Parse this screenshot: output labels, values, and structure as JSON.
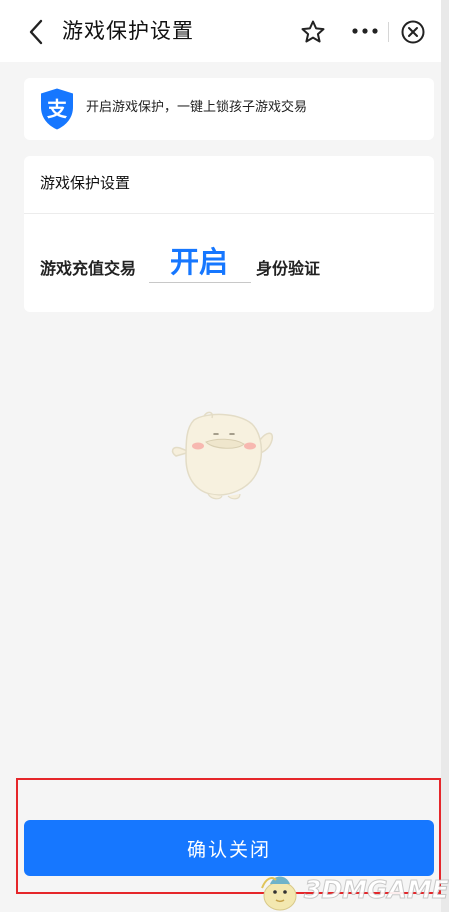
{
  "nav": {
    "title": "游戏保护设置",
    "back_icon": "chevron-left-icon",
    "star_icon": "star-icon",
    "more_icon": "more-icon",
    "close_icon": "close-circle-icon"
  },
  "notice": {
    "icon": "alipay-shield-icon",
    "icon_glyph": "支",
    "text": "开启游戏保护，一键上锁孩子游戏交易"
  },
  "settings": {
    "title": "游戏保护设置",
    "row": {
      "label": "游戏充值交易",
      "value": "开启",
      "suffix": "身份验证"
    }
  },
  "confirm": {
    "label": "确认关闭"
  },
  "watermark": {
    "text": "3DMGAME"
  },
  "colors": {
    "accent": "#1677ff",
    "background": "#f5f5f5",
    "highlight": "#e5262a",
    "card": "#ffffff"
  }
}
